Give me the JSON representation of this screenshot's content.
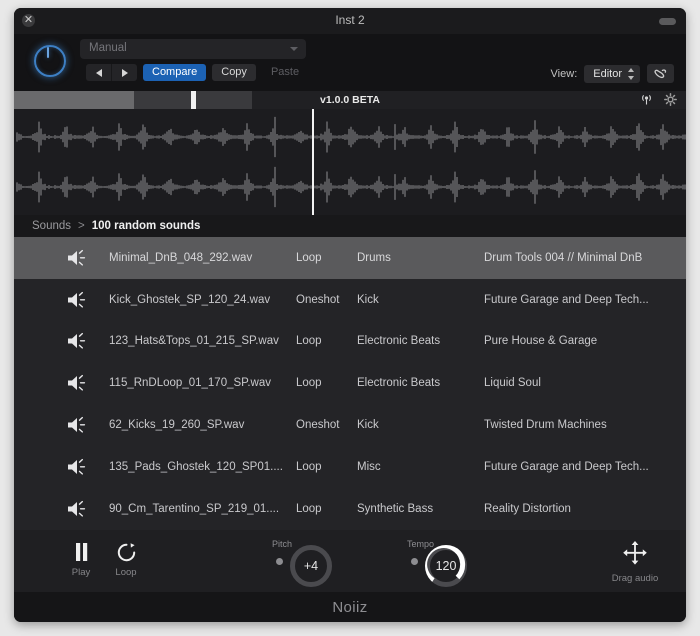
{
  "window": {
    "title": "Inst 2",
    "close_icon": "close-icon",
    "resize_pill": "window-pill-button"
  },
  "toolbar": {
    "power_icon": "power-icon",
    "preset": {
      "value": "Manual",
      "caret_icon": "chevron-down-icon"
    },
    "prev_label": "◀",
    "next_label": "▶",
    "compare_label": "Compare",
    "copy_label": "Copy",
    "paste_label": "Paste",
    "view_label": "View:",
    "view_value": "Editor",
    "link_icon": "link-icon",
    "accent_color": "#1c62b4"
  },
  "version_strip": {
    "text": "v1.0.0 BETA",
    "antenna_icon": "broadcast-icon",
    "gear_icon": "gear-icon"
  },
  "waveform": {
    "playhead_label": "playhead",
    "wave_color": "#8e8e92"
  },
  "breadcrumb": {
    "root": "Sounds",
    "separator": ">",
    "current": "100 random sounds"
  },
  "sounds": [
    {
      "icon": "speaker-icon",
      "name": "Minimal_DnB_048_292.wav",
      "type": "Loop",
      "category": "Drums",
      "pack": "Drum Tools 004 // Minimal DnB",
      "selected": true
    },
    {
      "icon": "speaker-icon",
      "name": "Kick_Ghostek_SP_120_24.wav",
      "type": "Oneshot",
      "category": "Kick",
      "pack": "Future Garage and Deep Tech...",
      "selected": false
    },
    {
      "icon": "speaker-icon",
      "name": "123_Hats&Tops_01_215_SP.wav",
      "type": "Loop",
      "category": "Electronic Beats",
      "pack": "Pure House & Garage",
      "selected": false
    },
    {
      "icon": "speaker-icon",
      "name": "115_RnDLoop_01_170_SP.wav",
      "type": "Loop",
      "category": "Electronic Beats",
      "pack": "Liquid Soul",
      "selected": false
    },
    {
      "icon": "speaker-icon",
      "name": "62_Kicks_19_260_SP.wav",
      "type": "Oneshot",
      "category": "Kick",
      "pack": "Twisted Drum Machines",
      "selected": false
    },
    {
      "icon": "speaker-icon",
      "name": "135_Pads_Ghostek_120_SP01....",
      "type": "Loop",
      "category": "Misc",
      "pack": "Future Garage and Deep Tech...",
      "selected": false
    },
    {
      "icon": "speaker-icon",
      "name": "90_Cm_Tarentino_SP_219_01....",
      "type": "Loop",
      "category": "Synthetic Bass",
      "pack": "Reality Distortion",
      "selected": false
    }
  ],
  "transport": {
    "play_label": "Play",
    "play_icon": "pause-icon",
    "loop_label": "Loop",
    "loop_icon": "loop-icon",
    "pitch_label": "Pitch",
    "pitch_value": "+4",
    "tempo_label": "Tempo",
    "tempo_value": "120",
    "drag_label": "Drag audio",
    "drag_icon": "move-icon"
  },
  "footer": {
    "brand": "Noiiz"
  }
}
